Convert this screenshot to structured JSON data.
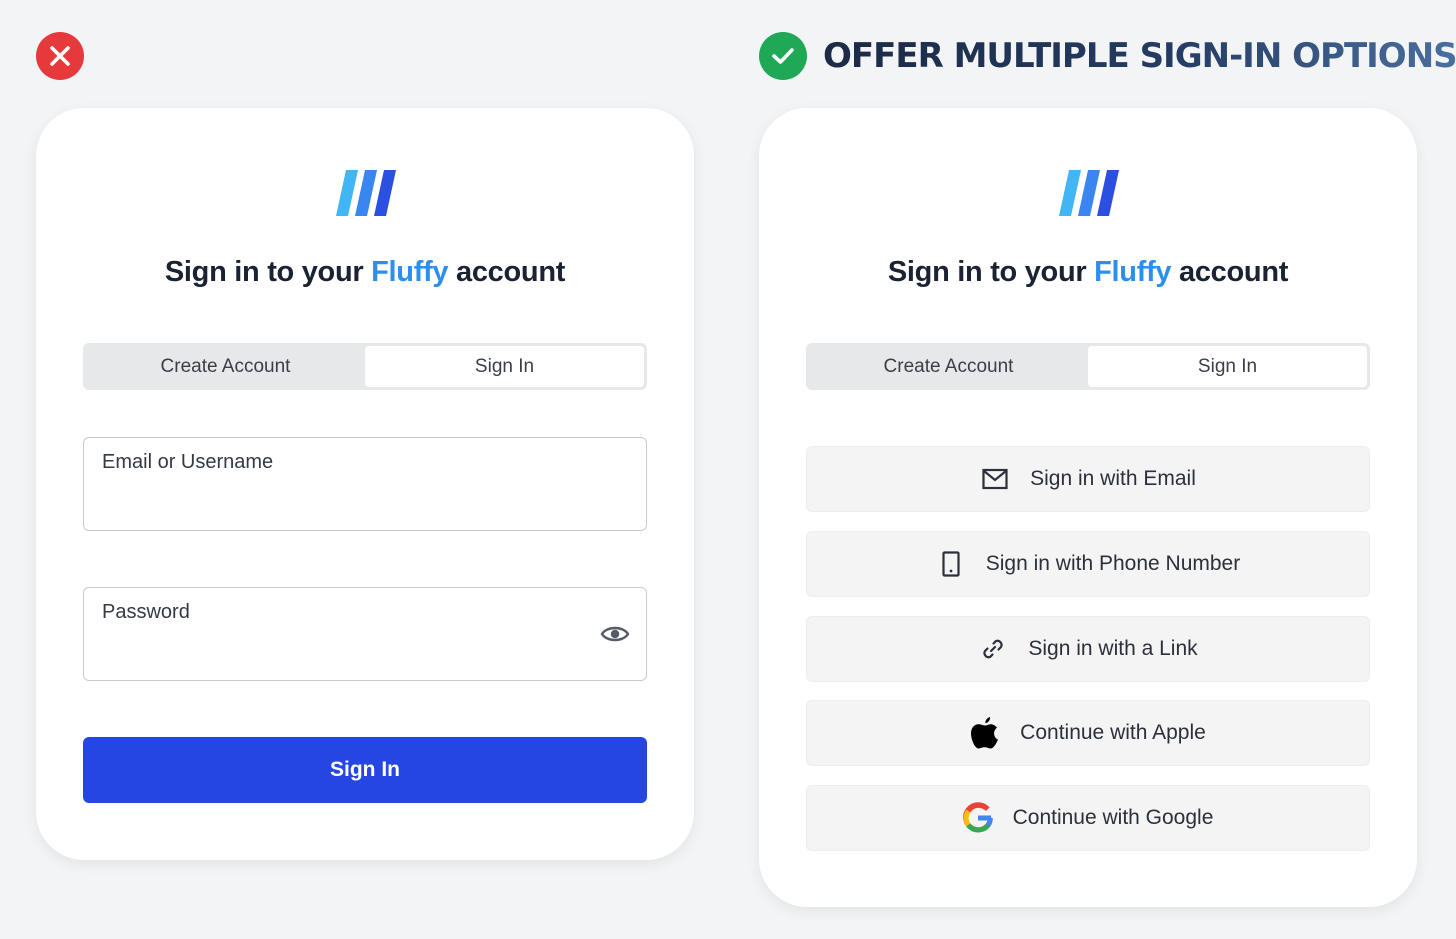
{
  "left_panel": {
    "status": "bad",
    "title_prefix": "Sign in to your ",
    "title_brand": "Fluffy",
    "title_suffix": " account",
    "tabs": [
      {
        "label": "Create Account",
        "active": false
      },
      {
        "label": "Sign In",
        "active": true
      }
    ],
    "fields": {
      "email_label": "Email or Username",
      "email_value": "",
      "password_label": "Password",
      "password_value": ""
    },
    "submit_label": "Sign In"
  },
  "right_panel": {
    "status": "good",
    "headline": "OFFER MULTIPLE SIGN-IN OPTIONS",
    "title_prefix": "Sign in to your ",
    "title_brand": "Fluffy",
    "title_suffix": " account",
    "tabs": [
      {
        "label": "Create Account",
        "active": false
      },
      {
        "label": "Sign In",
        "active": true
      }
    ],
    "options": [
      {
        "icon": "mail-icon",
        "label": "Sign in with Email"
      },
      {
        "icon": "phone-icon",
        "label": "Sign in with Phone Number"
      },
      {
        "icon": "link-icon",
        "label": "Sign in with a Link"
      },
      {
        "icon": "apple-icon",
        "label": "Continue with Apple"
      },
      {
        "icon": "google-icon",
        "label": "Continue with Google"
      }
    ]
  },
  "colors": {
    "background": "#f3f4f6",
    "brand_blue": "#2b8ff0",
    "primary_button": "#2546e3",
    "bad_badge": "#e5393c",
    "good_badge": "#1fa855"
  }
}
